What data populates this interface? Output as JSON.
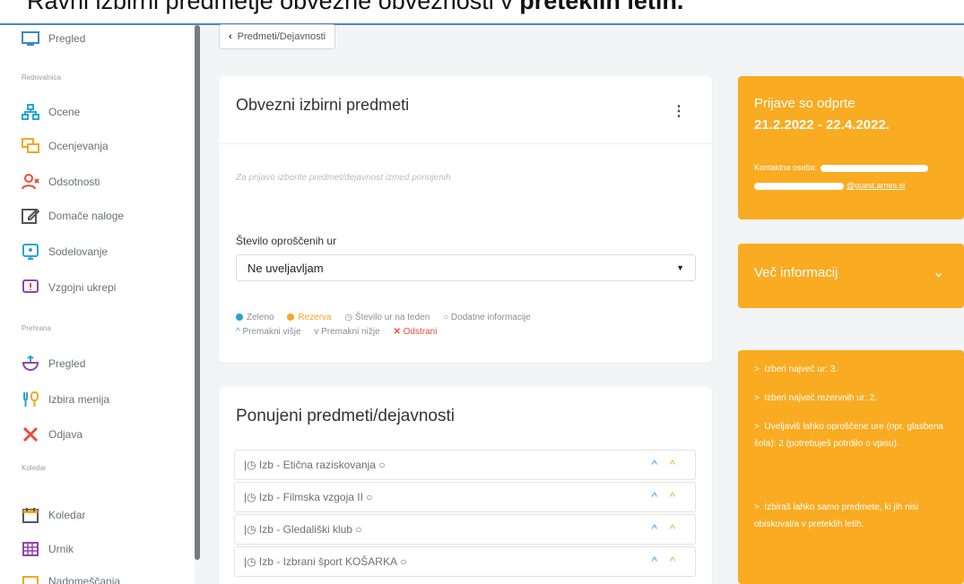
{
  "banner": {
    "text_normal": "Ravni izbirni predmetje obvezne obveznosti v ",
    "text_bold": "preteklih letih."
  },
  "sidebar": {
    "items": [
      {
        "label": "Pregled",
        "icon": "monitor-icon"
      },
      {
        "section": "Redovalnica"
      },
      {
        "label": "Ocene",
        "icon": "org-chart-icon"
      },
      {
        "label": "Ocenjevanja",
        "icon": "chat-bubbles-icon"
      },
      {
        "label": "Odsotnosti",
        "icon": "user-x-icon"
      },
      {
        "label": "Domače naloge",
        "icon": "edit-icon"
      },
      {
        "label": "Sodelovanje",
        "icon": "presentation-icon"
      },
      {
        "label": "Vzgojni ukrepi",
        "icon": "alert-message-icon"
      },
      {
        "section": "Prehrana"
      },
      {
        "label": "Pregled",
        "icon": "bowl-icon"
      },
      {
        "label": "Izbira menija",
        "icon": "menu-icon"
      },
      {
        "label": "Odjava",
        "icon": "cutlery-x-icon"
      },
      {
        "section": "Koledar"
      },
      {
        "label": "Koledar",
        "icon": "calendar-icon"
      },
      {
        "label": "Urnik",
        "icon": "timetable-icon"
      },
      {
        "label": "Nadomeščanja",
        "icon": "calendar-swap-icon"
      }
    ]
  },
  "back_button": {
    "label": "Predmeti/Dejavnosti"
  },
  "card1": {
    "title": "Obvezni izbirni predmeti",
    "hint": "Za prijavo izberite predmet/dejavnost izmed ponujenih",
    "select_label": "Število oproščenih ur",
    "select_value": "Ne uveljavljam",
    "legend": {
      "green": "Zeleno",
      "orange": "Rezerva",
      "hours": "Število ur na teden",
      "info": "Dodatne informacije",
      "up": "Premakni višje",
      "down": "Premakni nižje",
      "remove": "Odstrani"
    }
  },
  "card2": {
    "title": "Ponujeni predmeti/dejavnosti",
    "rows": [
      "Izb - Etična raziskovanja",
      "Izb - Filmska vzgoja II",
      "Izb - Gledališki klub",
      "Izb - Izbrani šport KOŠARKA"
    ]
  },
  "right": {
    "box1": {
      "line1": "Prijave so odprte",
      "line2": "21.2.2022 - 22.4.2022.",
      "contact_label": "Kontaktna oseba:",
      "email_suffix": "@guest.arnes.si"
    },
    "box2": {
      "title": "Več informacij"
    },
    "box3": {
      "items": [
        "Izberi največ ur: 3.",
        "Izberi največ rezervnih ur: 2.",
        "Uveljaviš lahko oproščene ure (npr. glasbena šola): 2 (potrebuješ potrdilo o vpisu).",
        "Izbiraš lahko samo predmete, ki jih nisi obiskoval/a v preteklih letih."
      ]
    }
  },
  "colors": {
    "accent_blue": "#29a3d8",
    "accent_orange": "#f9ab21",
    "remove_red": "#e74c3c"
  }
}
